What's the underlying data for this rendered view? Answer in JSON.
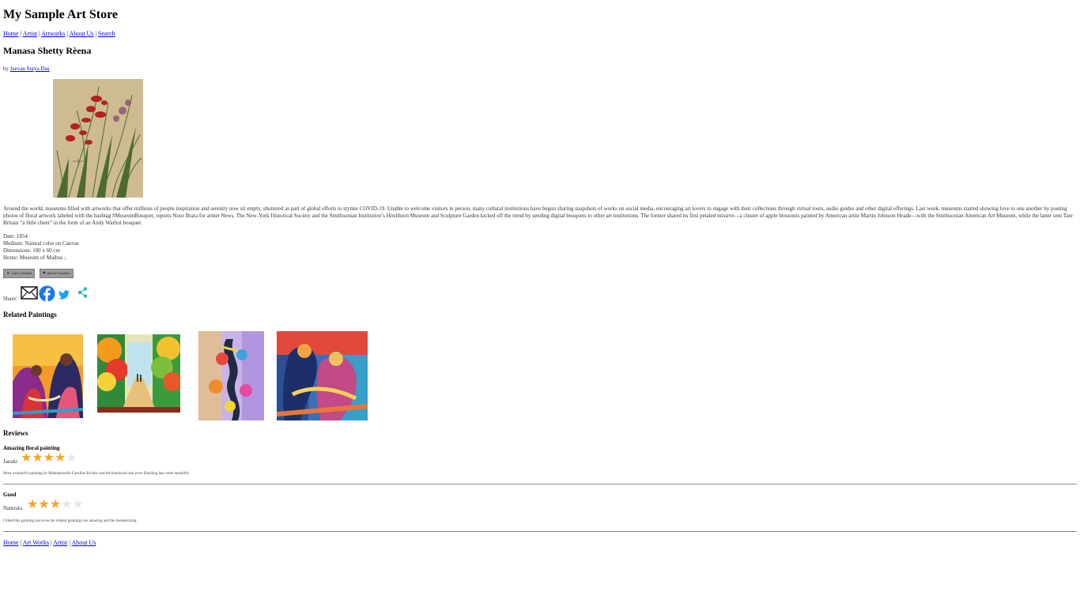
{
  "store": {
    "title": "My Sample Art Store"
  },
  "nav": {
    "items": [
      {
        "label": "Home"
      },
      {
        "label": "Artist"
      },
      {
        "label": "Artworks"
      },
      {
        "label": "About Us"
      },
      {
        "label": "Search"
      }
    ],
    "separator": "|"
  },
  "artwork": {
    "title": "Manasa Shetty Rèena",
    "by_prefix": "by",
    "artist": "Jeevan Surya Das",
    "description": "Around the world, museums filled with artworks that offer millions of people inspiration and serenity now sit empty, shuttered as part of global efforts to stymie COVID-19. Unable to welcome visitors in person, many cultural institutions have begun sharing snapshots of works on social media, encouraging art lovers to engage with their collections through virtual tours, audio guides and other digital offerings. Last week, museums started showing love to one another by posting photos of floral artwork labeled with the hashtag #MuseumBouquet, reports Noor Brara for artnet News. The New-York Historical Society and the Smithsonian Institution’s Hirshhorn Museum and Sculpture Garden kicked off the trend by sending digital bouquets to other art institutions. The former shared its first petaled missive—a cluster of apple blossoms painted by American artist Martin Johnson Heade—with the Smithsonian American Art Museum, while the latter sent Tate Britain “a little cheer” in the form of an Andy Warhol bouquet.",
    "date": "Date: 1854",
    "medium": "Medium: Natural color on Canvas",
    "dimensions": "Dimensions: 100 x 60 cm",
    "home": "Home: Museum of Madras ;"
  },
  "actions": {
    "add_to_basket": "Add to Basket",
    "add_to_favorites": "Add to Favorites"
  },
  "share": {
    "label": "Share:",
    "icons": [
      "envelope-icon",
      "facebook-icon",
      "twitter-icon",
      "share-icon"
    ]
  },
  "related": {
    "heading": "Related Paintings"
  },
  "reviews": {
    "heading": "Reviews",
    "items": [
      {
        "title": "Amazing floral painting",
        "author": "Janaki",
        "rating": 4,
        "max": 5,
        "body": "Most wonderful painting by Mademoiselle Caroline Rivière and the handwork and even finishing has come beautiful."
      },
      {
        "title": "Good",
        "author": "Namrata",
        "rating": 3,
        "max": 5,
        "body": "I liked this painting and even the related paintings are amazing and the mesmerizing."
      }
    ]
  },
  "footer": {
    "items": [
      {
        "label": "Home"
      },
      {
        "label": "Art Works"
      },
      {
        "label": "Artist"
      },
      {
        "label": "About Us"
      }
    ]
  },
  "colors": {
    "link": "#0000ee",
    "star_on": "#f5a623",
    "star_off": "#e6e6e6",
    "button_bg": "#9b9b9b"
  }
}
